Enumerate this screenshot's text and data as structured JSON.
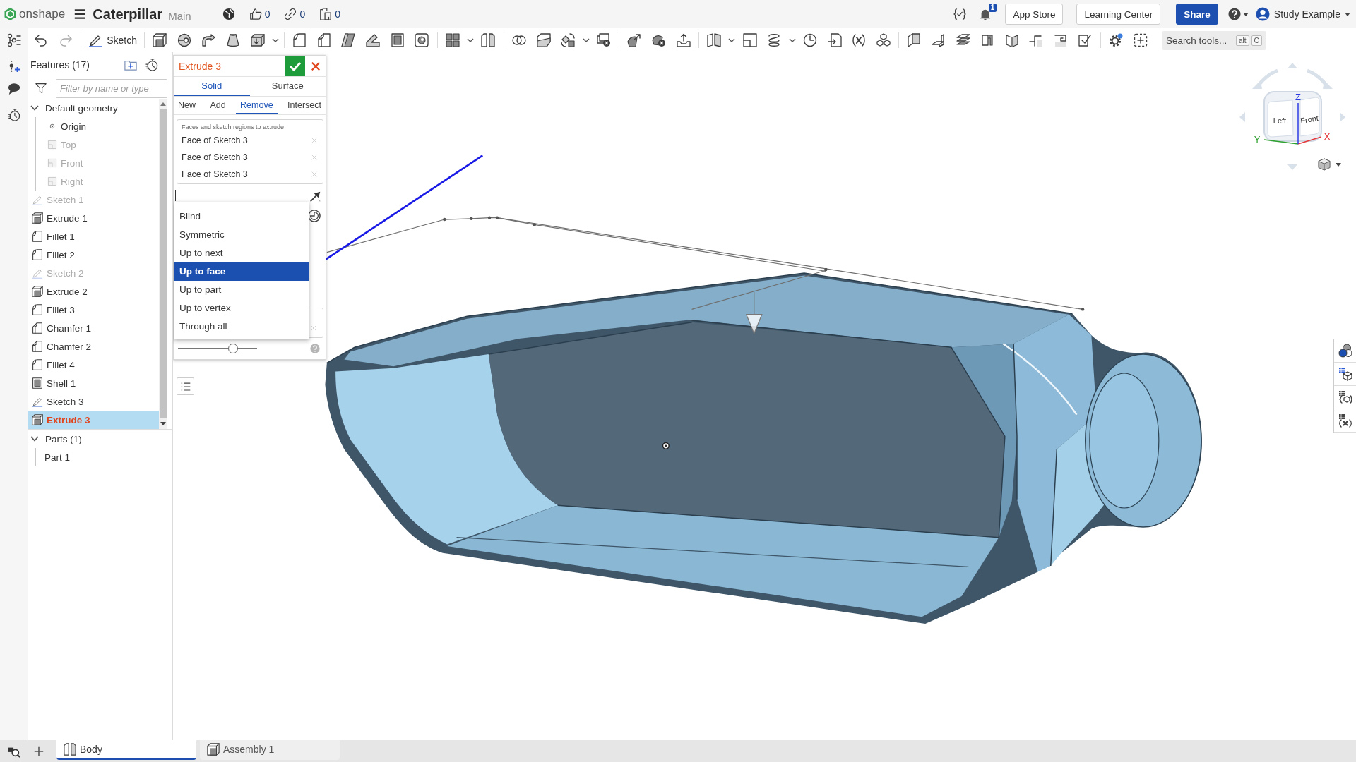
{
  "header": {
    "logo_text": "onshape",
    "title": "Caterpillar",
    "branch": "Main",
    "counts": [
      {
        "kind": "likes",
        "value": "0"
      },
      {
        "kind": "links",
        "value": "0"
      },
      {
        "kind": "copies",
        "value": "0"
      }
    ],
    "notifications": "1",
    "buttons": [
      {
        "label": "App Store",
        "kind": "outline"
      },
      {
        "label": "Learning Center",
        "kind": "outline"
      },
      {
        "label": "Share",
        "kind": "primary"
      }
    ],
    "user": "Study Example"
  },
  "toolbar": {
    "sketch_label": "Sketch",
    "search": {
      "placeholder": "Search tools...",
      "keys": [
        "alt",
        "C"
      ]
    }
  },
  "features": {
    "title": "Features (17)",
    "filter": {
      "placeholder": "Filter by name or type"
    },
    "tree": [
      {
        "label": "Default geometry",
        "kind": "group",
        "expanded": true,
        "selected": false,
        "hidden": false,
        "children": [
          {
            "label": "Origin",
            "kind": "point",
            "selected": false,
            "hidden": false
          },
          {
            "label": "Top",
            "kind": "plane",
            "selected": false,
            "hidden": true
          },
          {
            "label": "Front",
            "kind": "plane",
            "selected": false,
            "hidden": true
          },
          {
            "label": "Right",
            "kind": "plane",
            "selected": false,
            "hidden": true
          }
        ]
      },
      {
        "label": "Sketch 1",
        "kind": "sketch",
        "selected": false,
        "hidden": true
      },
      {
        "label": "Extrude 1",
        "kind": "extrude",
        "selected": false,
        "hidden": false
      },
      {
        "label": "Fillet 1",
        "kind": "fillet",
        "selected": false,
        "hidden": false
      },
      {
        "label": "Fillet 2",
        "kind": "fillet",
        "selected": false,
        "hidden": false
      },
      {
        "label": "Sketch 2",
        "kind": "sketch",
        "selected": false,
        "hidden": true
      },
      {
        "label": "Extrude 2",
        "kind": "extrude",
        "selected": false,
        "hidden": false
      },
      {
        "label": "Fillet 3",
        "kind": "fillet",
        "selected": false,
        "hidden": false
      },
      {
        "label": "Chamfer 1",
        "kind": "chamfer",
        "selected": false,
        "hidden": false
      },
      {
        "label": "Chamfer 2",
        "kind": "chamfer",
        "selected": false,
        "hidden": false
      },
      {
        "label": "Fillet 4",
        "kind": "fillet",
        "selected": false,
        "hidden": false
      },
      {
        "label": "Shell 1",
        "kind": "shell",
        "selected": false,
        "hidden": false
      },
      {
        "label": "Sketch 3",
        "kind": "sketch",
        "selected": false,
        "hidden": false
      },
      {
        "label": "Extrude 3",
        "kind": "extrude",
        "selected": true,
        "hidden": false
      }
    ],
    "parts": [
      {
        "label": "Parts (1)",
        "kind": "group",
        "expanded": true,
        "selected": false,
        "hidden": false,
        "children": [
          {
            "label": "Part 1",
            "kind": "part",
            "selected": false,
            "hidden": false
          }
        ]
      }
    ]
  },
  "extrude_dialog": {
    "title": "Extrude 3",
    "body_tabs": [
      {
        "label": "Solid",
        "selected": true
      },
      {
        "label": "Surface",
        "selected": false
      }
    ],
    "operation_tabs": [
      {
        "label": "New",
        "selected": false
      },
      {
        "label": "Add",
        "selected": false
      },
      {
        "label": "Remove",
        "selected": true
      },
      {
        "label": "Intersect",
        "selected": false
      }
    ],
    "selection_label": "Faces and sketch regions to extrude",
    "selections": [
      "Face of Sketch 3",
      "Face of Sketch 3",
      "Face of Sketch 3"
    ],
    "end_type": {
      "open": true,
      "options": [
        {
          "label": "Blind",
          "selected": false
        },
        {
          "label": "Symmetric",
          "selected": false
        },
        {
          "label": "Up to next",
          "selected": false
        },
        {
          "label": "Up to face",
          "selected": true
        },
        {
          "label": "Up to part",
          "selected": false
        },
        {
          "label": "Up to vertex",
          "selected": false
        },
        {
          "label": "Through all",
          "selected": false
        }
      ]
    },
    "slider": {
      "level": 0.7
    }
  },
  "view_cube": {
    "faces": [
      "Left",
      "Front"
    ],
    "axes": [
      {
        "label": "X",
        "color": "#e5393c"
      },
      {
        "label": "Y",
        "color": "#2ea12e"
      },
      {
        "label": "Z",
        "color": "#2c3be0"
      }
    ]
  },
  "tabs": [
    {
      "label": "Body",
      "kind": "part_studio",
      "selected": true
    },
    {
      "label": "Assembly 1",
      "kind": "assembly",
      "selected": false
    }
  ]
}
